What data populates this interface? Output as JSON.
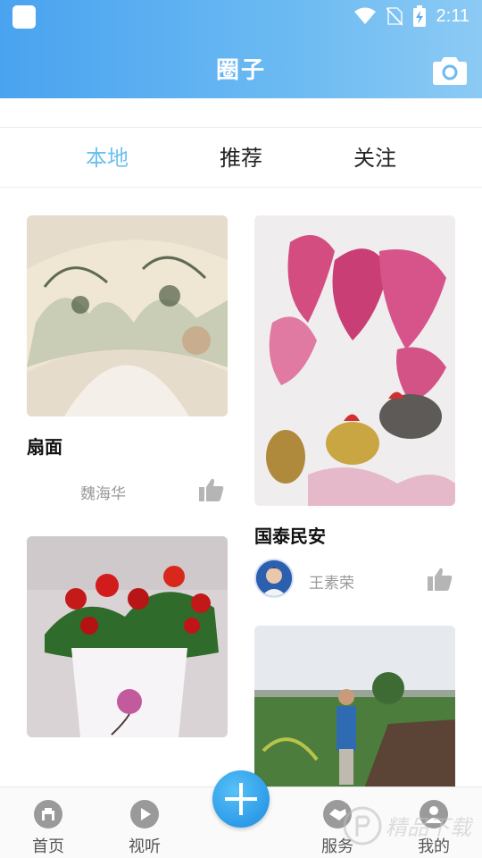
{
  "status_bar": {
    "time": "2:11"
  },
  "header": {
    "title": "圈子"
  },
  "tabs": [
    {
      "label": "本地",
      "active": true
    },
    {
      "label": "推荐",
      "active": false
    },
    {
      "label": "关注",
      "active": false
    }
  ],
  "posts": [
    {
      "title": "扇面",
      "author": "魏海华"
    },
    {
      "title": "国泰民安",
      "author": "王素荣"
    }
  ],
  "bottom_nav": {
    "items": [
      {
        "label": "首页"
      },
      {
        "label": "视听"
      },
      {
        "label": "服务"
      },
      {
        "label": "我的"
      }
    ]
  },
  "watermark": {
    "text": "精品下载"
  },
  "colors": {
    "header_start": "#4aa3f0",
    "header_end": "#8ccaf4",
    "active_tab": "#6cc0ee",
    "plus": "#2d9be8"
  }
}
